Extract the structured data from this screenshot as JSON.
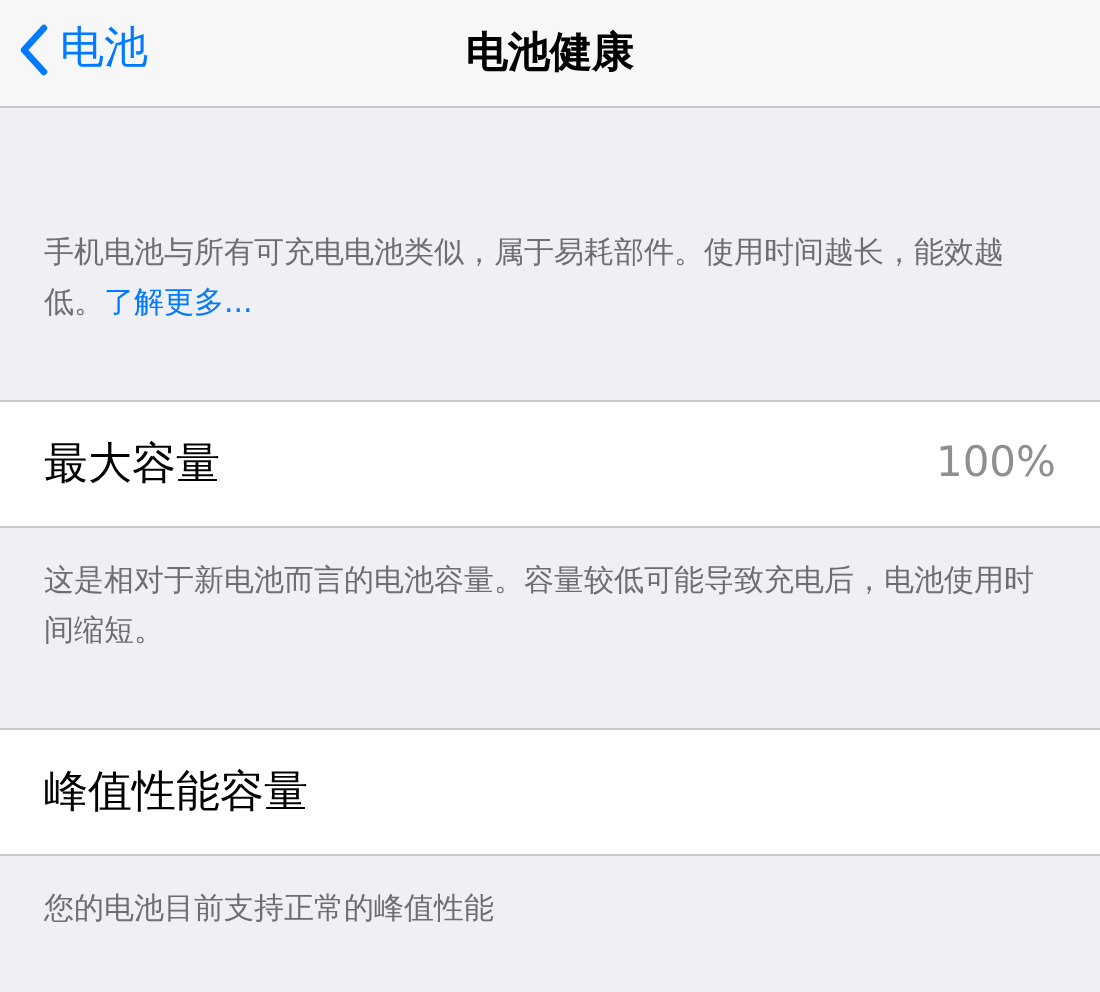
{
  "nav": {
    "back_label": "电池",
    "title": "电池健康"
  },
  "sections": [
    {
      "kind": "note",
      "text": "手机电池与所有可充电电池类似，属于易耗部件。使用时间越长，能效越低。",
      "link": "了解更多..."
    },
    {
      "kind": "row",
      "label": "最大容量",
      "value": "100%"
    },
    {
      "kind": "note",
      "text": "这是相对于新电池而言的电池容量。容量较低可能导致充电后，电池使用时间缩短。"
    },
    {
      "kind": "row",
      "label": "峰值性能容量"
    },
    {
      "kind": "note",
      "text": "您的电池目前支持正常的峰值性能"
    }
  ]
}
